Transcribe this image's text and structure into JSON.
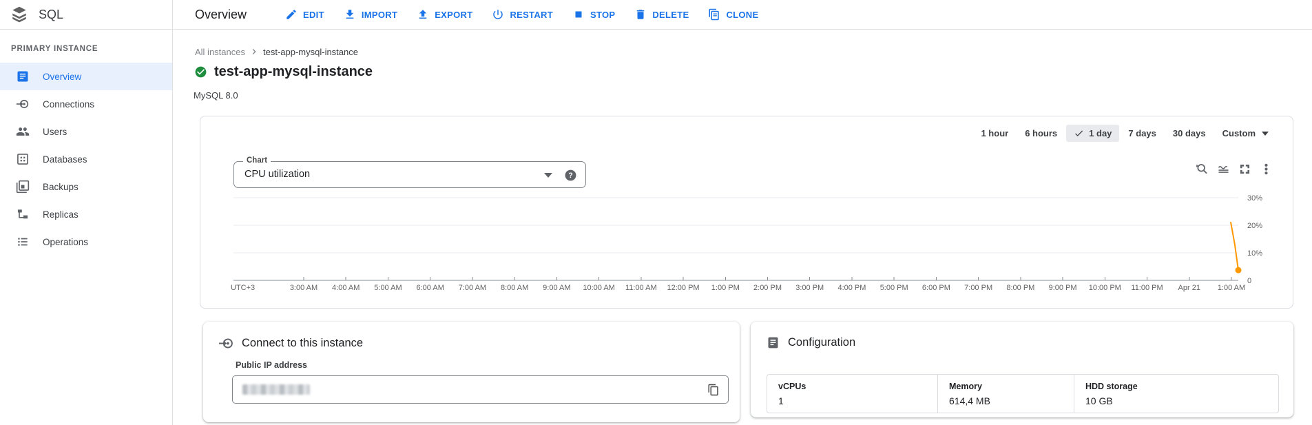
{
  "header": {
    "product": "SQL",
    "page_title": "Overview",
    "actions": [
      {
        "label": "EDIT",
        "icon": "pencil-icon"
      },
      {
        "label": "IMPORT",
        "icon": "import-icon"
      },
      {
        "label": "EXPORT",
        "icon": "export-icon"
      },
      {
        "label": "RESTART",
        "icon": "power-icon"
      },
      {
        "label": "STOP",
        "icon": "stop-icon"
      },
      {
        "label": "DELETE",
        "icon": "trash-icon"
      },
      {
        "label": "CLONE",
        "icon": "clone-icon"
      }
    ]
  },
  "sidebar": {
    "section_label": "PRIMARY INSTANCE",
    "items": [
      {
        "label": "Overview",
        "icon": "overview-icon",
        "selected": true
      },
      {
        "label": "Connections",
        "icon": "connections-icon",
        "selected": false
      },
      {
        "label": "Users",
        "icon": "users-icon",
        "selected": false
      },
      {
        "label": "Databases",
        "icon": "databases-icon",
        "selected": false
      },
      {
        "label": "Backups",
        "icon": "backups-icon",
        "selected": false
      },
      {
        "label": "Replicas",
        "icon": "replicas-icon",
        "selected": false
      },
      {
        "label": "Operations",
        "icon": "operations-icon",
        "selected": false
      }
    ]
  },
  "breadcrumb": {
    "parent": "All instances",
    "current": "test-app-mysql-instance"
  },
  "instance": {
    "name": "test-app-mysql-instance",
    "engine": "MySQL 8.0",
    "status": "healthy"
  },
  "metrics": {
    "time_ranges": [
      {
        "label": "1 hour",
        "selected": false
      },
      {
        "label": "6 hours",
        "selected": false
      },
      {
        "label": "1 day",
        "selected": true
      },
      {
        "label": "7 days",
        "selected": false
      },
      {
        "label": "30 days",
        "selected": false
      },
      {
        "label": "Custom",
        "selected": false,
        "has_caret": true
      }
    ],
    "chart_select": {
      "label": "Chart",
      "value": "CPU utilization"
    }
  },
  "chart_data": {
    "type": "line",
    "title": "CPU utilization",
    "timezone_label": "UTC+3",
    "x_tick_labels": [
      "3:00 AM",
      "4:00 AM",
      "5:00 AM",
      "6:00 AM",
      "7:00 AM",
      "8:00 AM",
      "9:00 AM",
      "10:00 AM",
      "11:00 AM",
      "12:00 PM",
      "1:00 PM",
      "2:00 PM",
      "3:00 PM",
      "4:00 PM",
      "5:00 PM",
      "6:00 PM",
      "7:00 PM",
      "8:00 PM",
      "9:00 PM",
      "10:00 PM",
      "11:00 PM",
      "Apr 21",
      "1:00 AM"
    ],
    "y_ticks": [
      {
        "label": "0",
        "value": 0
      },
      {
        "label": "10%",
        "value": 10
      },
      {
        "label": "20%",
        "value": 20
      },
      {
        "label": "30%",
        "value": 30
      }
    ],
    "ylim": [
      0,
      35
    ],
    "grid": true,
    "legend_position": "none",
    "series": [
      {
        "name": "CPU utilization",
        "color": "#ff9800",
        "end_dot": true,
        "points": [
          {
            "time": "12:55 AM",
            "cpu_pct": 21,
            "x_frac": 0.9925
          },
          {
            "time": "1:00 AM",
            "cpu_pct": 13,
            "x_frac": 0.9965
          },
          {
            "time": "1:05 AM",
            "cpu_pct": 3.7,
            "x_frac": 1.0
          }
        ]
      }
    ]
  },
  "connect_card": {
    "title": "Connect to this instance",
    "field_label": "Public IP address",
    "field_value_redacted": true
  },
  "config_card": {
    "title": "Configuration",
    "fields": [
      {
        "label": "vCPUs",
        "value": "1"
      },
      {
        "label": "Memory",
        "value": "614,4 MB"
      },
      {
        "label": "HDD storage",
        "value": "10 GB"
      }
    ]
  },
  "colors": {
    "accent": "#1a73e8",
    "selected_bg": "#e8f0fe",
    "series_orange": "#ff9800",
    "status_green": "#1e8e3e"
  }
}
